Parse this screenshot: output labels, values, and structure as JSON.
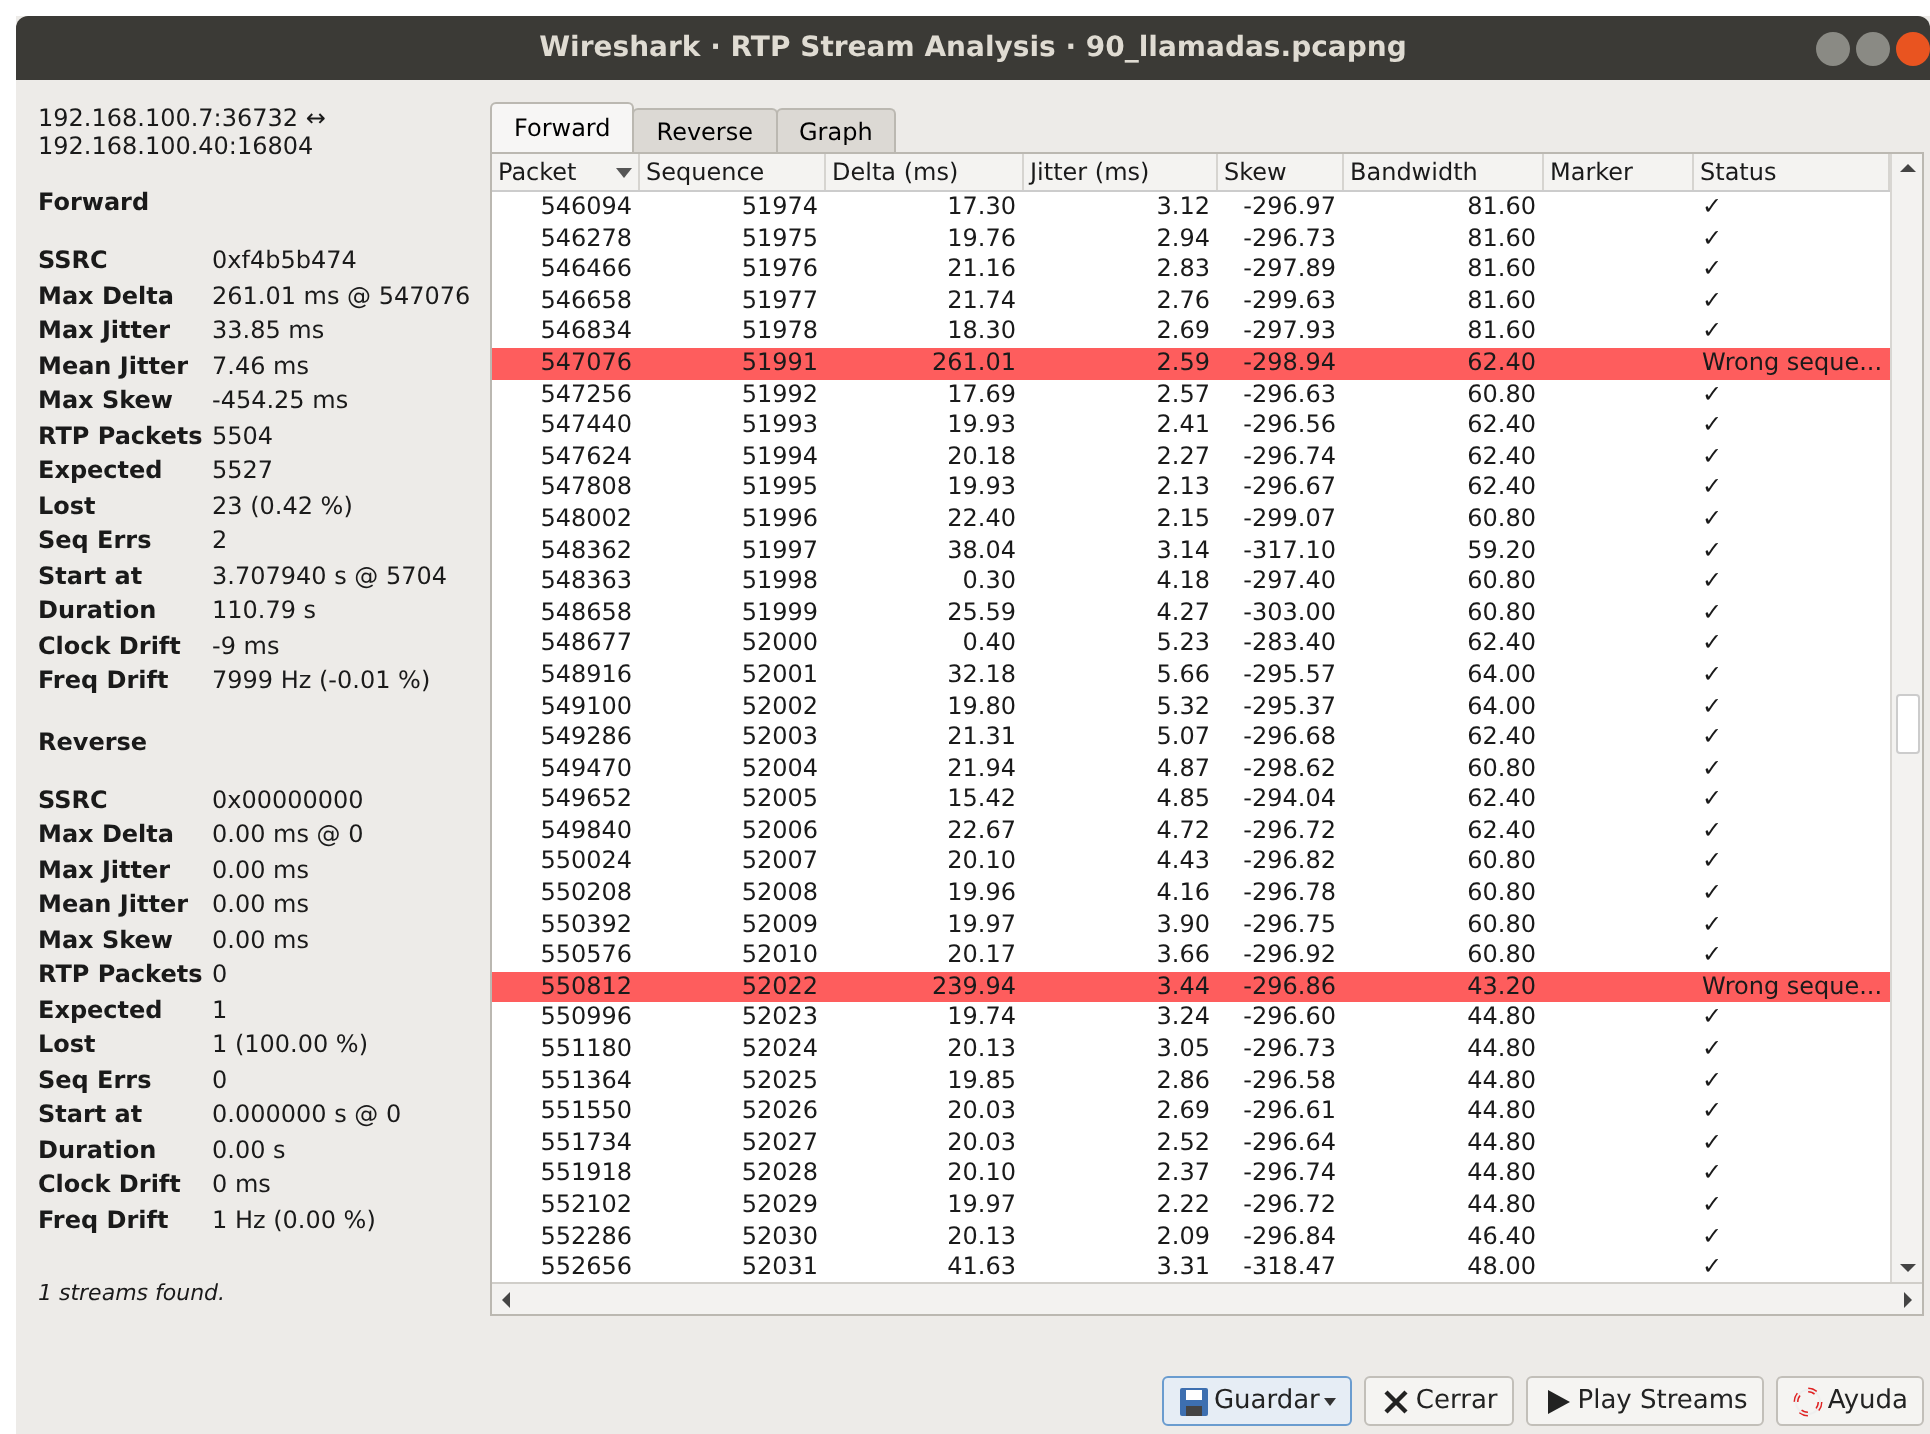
{
  "window": {
    "title": "Wireshark · RTP Stream Analysis · 90_llamadas.pcapng"
  },
  "stream": {
    "endpoints": [
      "192.168.100.7:36732 ↔",
      "192.168.100.40:16804"
    ]
  },
  "sections": [
    {
      "heading": "Forward",
      "stats": [
        {
          "label": "SSRC",
          "value": "0xf4b5b474"
        },
        {
          "label": "Max Delta",
          "value": "261.01 ms @ 547076"
        },
        {
          "label": "Max Jitter",
          "value": "33.85 ms"
        },
        {
          "label": "Mean Jitter",
          "value": "7.46 ms"
        },
        {
          "label": "Max Skew",
          "value": "-454.25 ms"
        },
        {
          "label": "RTP Packets",
          "value": "5504"
        },
        {
          "label": "Expected",
          "value": "5527"
        },
        {
          "label": "Lost",
          "value": "23 (0.42 %)"
        },
        {
          "label": "Seq Errs",
          "value": "2"
        },
        {
          "label": "Start at",
          "value": "3.707940 s @ 5704"
        },
        {
          "label": "Duration",
          "value": "110.79 s"
        },
        {
          "label": "Clock Drift",
          "value": "-9 ms"
        },
        {
          "label": "Freq Drift",
          "value": "7999 Hz (-0.01 %)"
        }
      ]
    },
    {
      "heading": "Reverse",
      "stats": [
        {
          "label": "SSRC",
          "value": "0x00000000"
        },
        {
          "label": "Max Delta",
          "value": "0.00 ms @ 0"
        },
        {
          "label": "Max Jitter",
          "value": "0.00 ms"
        },
        {
          "label": "Mean Jitter",
          "value": "0.00 ms"
        },
        {
          "label": "Max Skew",
          "value": "0.00 ms"
        },
        {
          "label": "RTP Packets",
          "value": "0"
        },
        {
          "label": "Expected",
          "value": "1"
        },
        {
          "label": "Lost",
          "value": "1 (100.00 %)"
        },
        {
          "label": "Seq Errs",
          "value": "0"
        },
        {
          "label": "Start at",
          "value": "0.000000 s @ 0"
        },
        {
          "label": "Duration",
          "value": "0.00 s"
        },
        {
          "label": "Clock Drift",
          "value": "0 ms"
        },
        {
          "label": "Freq Drift",
          "value": "1 Hz (0.00 %)"
        }
      ]
    }
  ],
  "status_text": "1 streams found.",
  "tabs": [
    {
      "label": "Forward",
      "selected": true
    },
    {
      "label": "Reverse",
      "selected": false
    },
    {
      "label": "Graph",
      "selected": false
    }
  ],
  "table": {
    "columns": [
      {
        "label": "Packet",
        "sorted": true
      },
      {
        "label": "Sequence",
        "sorted": false
      },
      {
        "label": "Delta (ms)",
        "sorted": false
      },
      {
        "label": "Jitter (ms)",
        "sorted": false
      },
      {
        "label": "Skew",
        "sorted": false
      },
      {
        "label": "Bandwidth",
        "sorted": false
      },
      {
        "label": "Marker",
        "sorted": false
      },
      {
        "label": "Status",
        "sorted": false
      }
    ],
    "rows": [
      {
        "cells": [
          "546094",
          "51974",
          "17.30",
          "3.12",
          "-296.97",
          "81.60",
          "",
          "✓"
        ],
        "error": false
      },
      {
        "cells": [
          "546278",
          "51975",
          "19.76",
          "2.94",
          "-296.73",
          "81.60",
          "",
          "✓"
        ],
        "error": false
      },
      {
        "cells": [
          "546466",
          "51976",
          "21.16",
          "2.83",
          "-297.89",
          "81.60",
          "",
          "✓"
        ],
        "error": false
      },
      {
        "cells": [
          "546658",
          "51977",
          "21.74",
          "2.76",
          "-299.63",
          "81.60",
          "",
          "✓"
        ],
        "error": false
      },
      {
        "cells": [
          "546834",
          "51978",
          "18.30",
          "2.69",
          "-297.93",
          "81.60",
          "",
          "✓"
        ],
        "error": false
      },
      {
        "cells": [
          "547076",
          "51991",
          "261.01",
          "2.59",
          "-298.94",
          "62.40",
          "",
          "Wrong seque..."
        ],
        "error": true
      },
      {
        "cells": [
          "547256",
          "51992",
          "17.69",
          "2.57",
          "-296.63",
          "60.80",
          "",
          "✓"
        ],
        "error": false
      },
      {
        "cells": [
          "547440",
          "51993",
          "19.93",
          "2.41",
          "-296.56",
          "62.40",
          "",
          "✓"
        ],
        "error": false
      },
      {
        "cells": [
          "547624",
          "51994",
          "20.18",
          "2.27",
          "-296.74",
          "62.40",
          "",
          "✓"
        ],
        "error": false
      },
      {
        "cells": [
          "547808",
          "51995",
          "19.93",
          "2.13",
          "-296.67",
          "62.40",
          "",
          "✓"
        ],
        "error": false
      },
      {
        "cells": [
          "548002",
          "51996",
          "22.40",
          "2.15",
          "-299.07",
          "60.80",
          "",
          "✓"
        ],
        "error": false
      },
      {
        "cells": [
          "548362",
          "51997",
          "38.04",
          "3.14",
          "-317.10",
          "59.20",
          "",
          "✓"
        ],
        "error": false
      },
      {
        "cells": [
          "548363",
          "51998",
          "0.30",
          "4.18",
          "-297.40",
          "60.80",
          "",
          "✓"
        ],
        "error": false
      },
      {
        "cells": [
          "548658",
          "51999",
          "25.59",
          "4.27",
          "-303.00",
          "60.80",
          "",
          "✓"
        ],
        "error": false
      },
      {
        "cells": [
          "548677",
          "52000",
          "0.40",
          "5.23",
          "-283.40",
          "62.40",
          "",
          "✓"
        ],
        "error": false
      },
      {
        "cells": [
          "548916",
          "52001",
          "32.18",
          "5.66",
          "-295.57",
          "64.00",
          "",
          "✓"
        ],
        "error": false
      },
      {
        "cells": [
          "549100",
          "52002",
          "19.80",
          "5.32",
          "-295.37",
          "64.00",
          "",
          "✓"
        ],
        "error": false
      },
      {
        "cells": [
          "549286",
          "52003",
          "21.31",
          "5.07",
          "-296.68",
          "62.40",
          "",
          "✓"
        ],
        "error": false
      },
      {
        "cells": [
          "549470",
          "52004",
          "21.94",
          "4.87",
          "-298.62",
          "60.80",
          "",
          "✓"
        ],
        "error": false
      },
      {
        "cells": [
          "549652",
          "52005",
          "15.42",
          "4.85",
          "-294.04",
          "62.40",
          "",
          "✓"
        ],
        "error": false
      },
      {
        "cells": [
          "549840",
          "52006",
          "22.67",
          "4.72",
          "-296.72",
          "62.40",
          "",
          "✓"
        ],
        "error": false
      },
      {
        "cells": [
          "550024",
          "52007",
          "20.10",
          "4.43",
          "-296.82",
          "60.80",
          "",
          "✓"
        ],
        "error": false
      },
      {
        "cells": [
          "550208",
          "52008",
          "19.96",
          "4.16",
          "-296.78",
          "60.80",
          "",
          "✓"
        ],
        "error": false
      },
      {
        "cells": [
          "550392",
          "52009",
          "19.97",
          "3.90",
          "-296.75",
          "60.80",
          "",
          "✓"
        ],
        "error": false
      },
      {
        "cells": [
          "550576",
          "52010",
          "20.17",
          "3.66",
          "-296.92",
          "60.80",
          "",
          "✓"
        ],
        "error": false
      },
      {
        "cells": [
          "550812",
          "52022",
          "239.94",
          "3.44",
          "-296.86",
          "43.20",
          "",
          "Wrong seque..."
        ],
        "error": true
      },
      {
        "cells": [
          "550996",
          "52023",
          "19.74",
          "3.24",
          "-296.60",
          "44.80",
          "",
          "✓"
        ],
        "error": false
      },
      {
        "cells": [
          "551180",
          "52024",
          "20.13",
          "3.05",
          "-296.73",
          "44.80",
          "",
          "✓"
        ],
        "error": false
      },
      {
        "cells": [
          "551364",
          "52025",
          "19.85",
          "2.86",
          "-296.58",
          "44.80",
          "",
          "✓"
        ],
        "error": false
      },
      {
        "cells": [
          "551550",
          "52026",
          "20.03",
          "2.69",
          "-296.61",
          "44.80",
          "",
          "✓"
        ],
        "error": false
      },
      {
        "cells": [
          "551734",
          "52027",
          "20.03",
          "2.52",
          "-296.64",
          "44.80",
          "",
          "✓"
        ],
        "error": false
      },
      {
        "cells": [
          "551918",
          "52028",
          "20.10",
          "2.37",
          "-296.74",
          "44.80",
          "",
          "✓"
        ],
        "error": false
      },
      {
        "cells": [
          "552102",
          "52029",
          "19.97",
          "2.22",
          "-296.72",
          "44.80",
          "",
          "✓"
        ],
        "error": false
      },
      {
        "cells": [
          "552286",
          "52030",
          "20.13",
          "2.09",
          "-296.84",
          "46.40",
          "",
          "✓"
        ],
        "error": false
      },
      {
        "cells": [
          "552656",
          "52031",
          "41.63",
          "3.31",
          "-318.47",
          "48.00",
          "",
          "✓"
        ],
        "error": false
      }
    ]
  },
  "buttons": [
    {
      "label": "Guardar",
      "kind": "save",
      "dropdown": true
    },
    {
      "label": "Cerrar",
      "kind": "close",
      "dropdown": false
    },
    {
      "label": "Play Streams",
      "kind": "play",
      "dropdown": false
    },
    {
      "label": "Ayuda",
      "kind": "help",
      "dropdown": false
    }
  ]
}
